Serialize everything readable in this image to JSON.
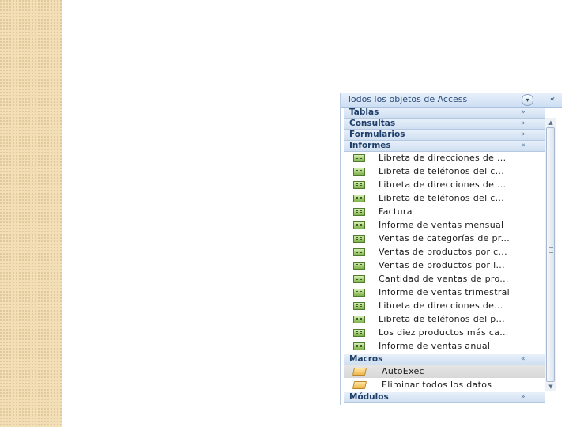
{
  "nav_pane": {
    "title": "Todos los objetos de Access",
    "dropdown_glyph": "▾",
    "collapse_glyph": "«",
    "groups": {
      "tablas": {
        "label": "Tablas",
        "chevron": "»"
      },
      "consultas": {
        "label": "Consultas",
        "chevron": "»"
      },
      "formularios": {
        "label": "Formularios",
        "chevron": "»"
      },
      "informes": {
        "label": "Informes",
        "chevron": "«"
      },
      "macros": {
        "label": "Macros",
        "chevron": "«"
      },
      "modulos": {
        "label": "Módulos",
        "chevron": "»"
      }
    },
    "informes_items": [
      {
        "label": "Libreta de direcciones de ..."
      },
      {
        "label": "Libreta de teléfonos del c..."
      },
      {
        "label": "Libreta de direcciones de ..."
      },
      {
        "label": "Libreta de teléfonos del c..."
      },
      {
        "label": "Factura"
      },
      {
        "label": "Informe de ventas mensual"
      },
      {
        "label": "Ventas de categorías de pr..."
      },
      {
        "label": "Ventas de productos por c..."
      },
      {
        "label": "Ventas de productos por i..."
      },
      {
        "label": "Cantidad de ventas de pro..."
      },
      {
        "label": "Informe de ventas trimestral"
      },
      {
        "label": "Libreta de direcciones de..."
      },
      {
        "label": "Libreta de teléfonos del p..."
      },
      {
        "label": "Los diez productos más ca..."
      },
      {
        "label": "Informe de ventas anual"
      }
    ],
    "macro_items": [
      {
        "label": "AutoExec",
        "selected": true
      },
      {
        "label": "Eliminar todos los datos",
        "selected": false
      }
    ],
    "scroll_up_glyph": "▲",
    "scroll_down_glyph": "▼"
  },
  "icons": {
    "report": "report-icon",
    "macro": "macro-icon"
  },
  "colors": {
    "side_strip": "#f2dfb6",
    "header_text": "#1f3f6b",
    "selection": "#dcdcdc"
  }
}
